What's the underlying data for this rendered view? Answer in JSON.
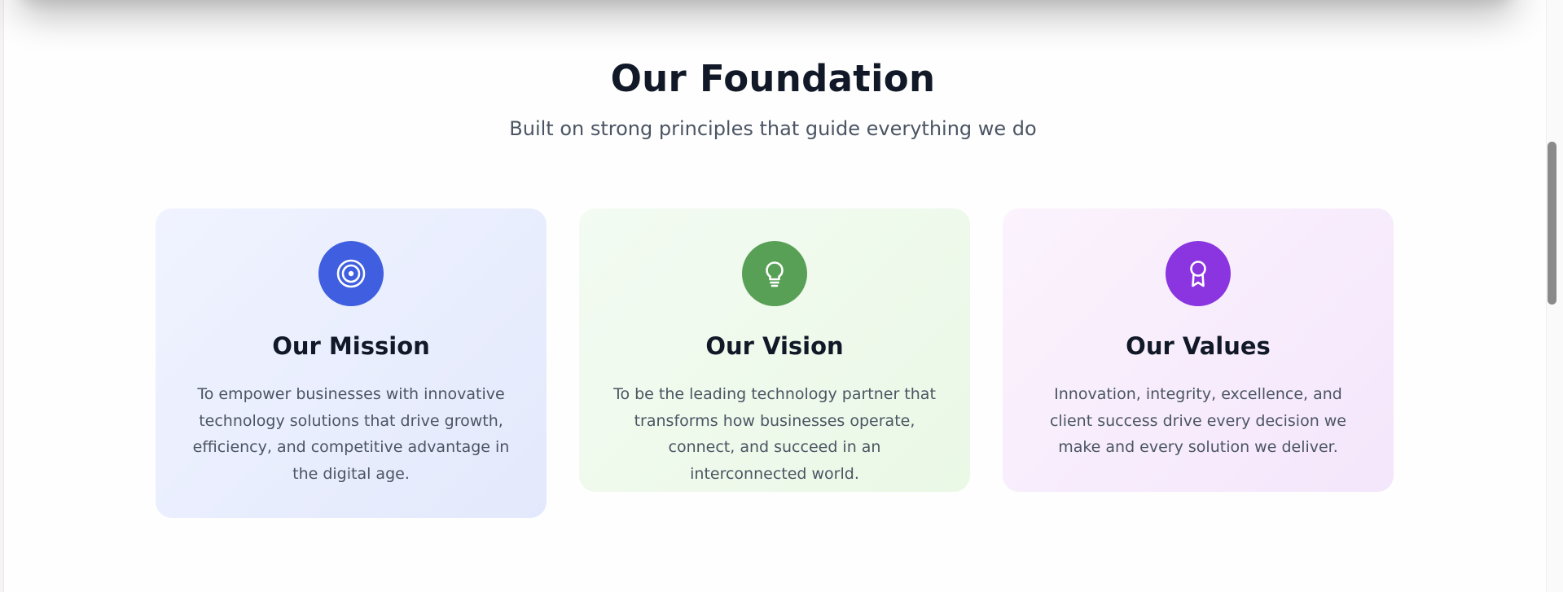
{
  "section": {
    "title": "Our Foundation",
    "subtitle": "Built on strong principles that guide everything we do"
  },
  "cards": [
    {
      "title": "Our Mission",
      "text": "To empower businesses with innovative technology solutions that drive growth, efficiency, and competitive advantage in the digital age.",
      "icon": "target-icon",
      "color": "#3f5fe0"
    },
    {
      "title": "Our Vision",
      "text": "To be the leading technology partner that transforms how businesses operate, connect, and succeed in an interconnected world.",
      "icon": "lightbulb-icon",
      "color": "#58a055"
    },
    {
      "title": "Our Values",
      "text": "Innovation, integrity, excellence, and client success drive every decision we make and every solution we deliver.",
      "icon": "award-icon",
      "color": "#8a35e0"
    }
  ]
}
